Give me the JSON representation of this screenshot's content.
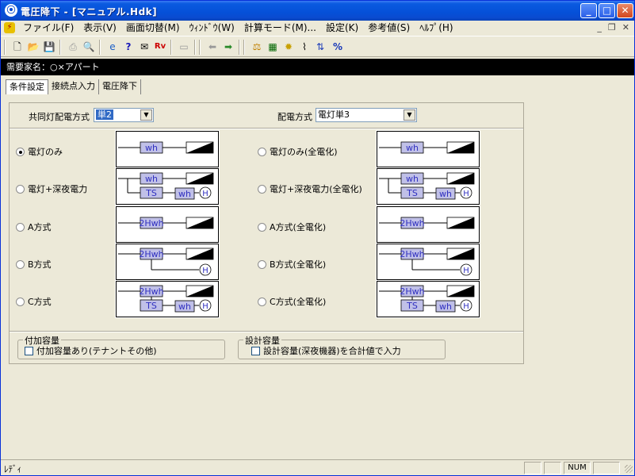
{
  "window": {
    "title": "電圧降下 - [マニュアル.Hdk]"
  },
  "menubar": {
    "items": [
      "ファイル(F)",
      "表示(V)",
      "画面切替(M)",
      "ｳｨﾝﾄﾞｳ(W)",
      "計算モード(M)...",
      "設定(K)",
      "参考値(S)",
      "ﾍﾙﾌﾟ(H)"
    ]
  },
  "customer": {
    "text": "需要家名：○×アパート"
  },
  "tabs": [
    "条件設定",
    "接続点入力",
    "電圧降下"
  ],
  "conditions": {
    "common_label": "共同灯配電方式",
    "common_value": "単2",
    "dist_label": "配電方式",
    "dist_value": "電灯単3",
    "left_options": [
      "電灯のみ",
      "電灯+深夜電力",
      "A方式",
      "B方式",
      "C方式"
    ],
    "right_options": [
      "電灯のみ(全電化)",
      "電灯+深夜電力(全電化)",
      "A方式(全電化)",
      "B方式(全電化)",
      "C方式(全電化)"
    ],
    "selected_left": 0,
    "meter_labels": {
      "wh": "wh",
      "ts": "TS",
      "hwh": "2Hwh",
      "h": "H"
    }
  },
  "groups": {
    "additional": {
      "title": "付加容量",
      "checkbox": "付加容量あり(テナントその他)",
      "checked": false
    },
    "design": {
      "title": "設計容量",
      "checkbox": "設計容量(深夜機器)を合計値で入力",
      "checked": false
    }
  },
  "status": {
    "text": "ﾚﾃﾞｨ",
    "num": "NUM"
  },
  "colors": {
    "meter_fill": "#c0c0e8",
    "meter_text": "#3030c0",
    "selection": "#316ac5"
  }
}
